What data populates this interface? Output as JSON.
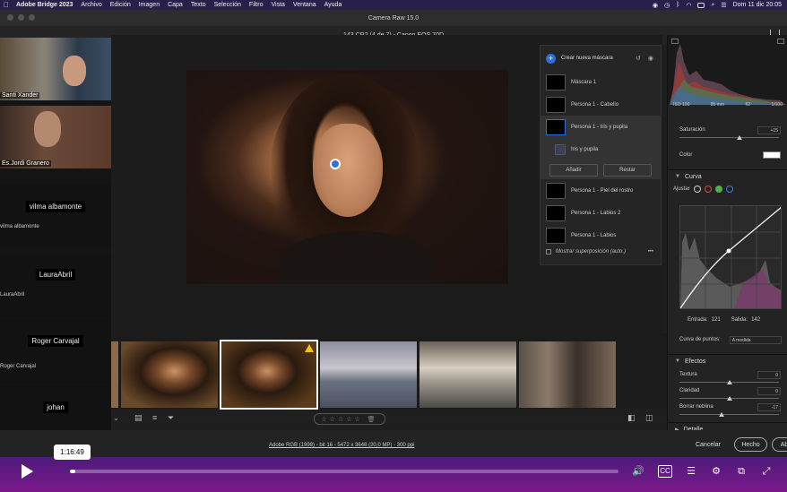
{
  "menubar": {
    "app": "Adobe Bridge 2023",
    "items": [
      "Archivo",
      "Edición",
      "Imagen",
      "Capa",
      "Texto",
      "Selección",
      "Filtro",
      "Vista",
      "Ventana",
      "Ayuda"
    ],
    "clock": "Dom 11 dic  20:05"
  },
  "window": {
    "title": "Camera Raw 15.0",
    "file_info": "143.CR2 (4 de 7)  -  Canon EOS 70D"
  },
  "call": {
    "participants": [
      {
        "label": "Santi Xander",
        "video": true
      },
      {
        "label": "Es.Jordi Granero",
        "video": true
      },
      {
        "name": "vilma albamonte",
        "label": "vilma albamonte"
      },
      {
        "name": "LauraAbril",
        "label": "LauraAbril"
      },
      {
        "name": "Roger Carvajal",
        "label": "Roger Carvajal"
      },
      {
        "name": "johan",
        "label": "johan"
      }
    ]
  },
  "masks": {
    "create_label": "Crear nueva máscara",
    "items": [
      {
        "label": "Máscara 1"
      },
      {
        "label": "Persona 1 - Cabello"
      },
      {
        "label": "Persona 1 - Iris y pupila"
      },
      {
        "label": "Iris y pupila"
      },
      {
        "label": "Persona 1 - Piel del rostro"
      },
      {
        "label": "Persona 1 - Labios 2"
      },
      {
        "label": "Persona 1 - Labios"
      }
    ],
    "add_label": "Añadir",
    "subtract_label": "Restar",
    "overlay_label": "Mostrar superposición (auto.)"
  },
  "histogram": {
    "iso": "ISO 100",
    "focal": "85 mm",
    "aperture": "f/2",
    "shutter": "1/100"
  },
  "panel": {
    "saturation_label": "Saturación",
    "saturation_value": "+15",
    "saturation_level": 0.6,
    "color_label": "Color",
    "curve_title": "Curva",
    "adjust_label": "Ajustar",
    "input_label": "Entrada:",
    "input_value": "121",
    "output_label": "Salida:",
    "output_value": "142",
    "point_curve_label": "Curva de puntos:",
    "point_curve_value": "A medida",
    "effects_title": "Efectos",
    "effects": [
      {
        "label": "Textura",
        "value": "0",
        "level": 0.5
      },
      {
        "label": "Claridad",
        "value": "0",
        "level": 0.5
      },
      {
        "label": "Borrar neblina",
        "value": "-17",
        "level": 0.42
      }
    ],
    "detail_title": "Detalle"
  },
  "footer": {
    "info": "Adobe RGB (1998) - bit 16 - 5472 x 3648 (20,0 MP) - 300 ppi",
    "cancel": "Cancelar",
    "done": "Hecho",
    "open": "Ab"
  },
  "player": {
    "time": "1:16:49",
    "progress": 0.01
  }
}
